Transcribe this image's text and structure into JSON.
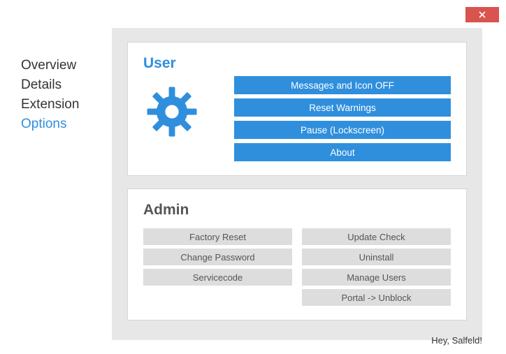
{
  "sidebar": {
    "items": [
      {
        "label": "Overview"
      },
      {
        "label": "Details"
      },
      {
        "label": "Extension"
      },
      {
        "label": "Options"
      }
    ]
  },
  "user_panel": {
    "title": "User",
    "buttons": {
      "messages": "Messages and Icon OFF",
      "reset": "Reset Warnings",
      "pause": "Pause (Lockscreen)",
      "about": "About"
    }
  },
  "admin_panel": {
    "title": "Admin",
    "left": {
      "factory_reset": "Factory Reset",
      "change_password": "Change Password",
      "servicecode": "Servicecode"
    },
    "right": {
      "update_check": "Update Check",
      "uninstall": "Uninstall",
      "manage_users": "Manage Users",
      "portal_unblock": "Portal -> Unblock"
    }
  },
  "footer": {
    "greeting": "Hey, Salfeld!"
  }
}
